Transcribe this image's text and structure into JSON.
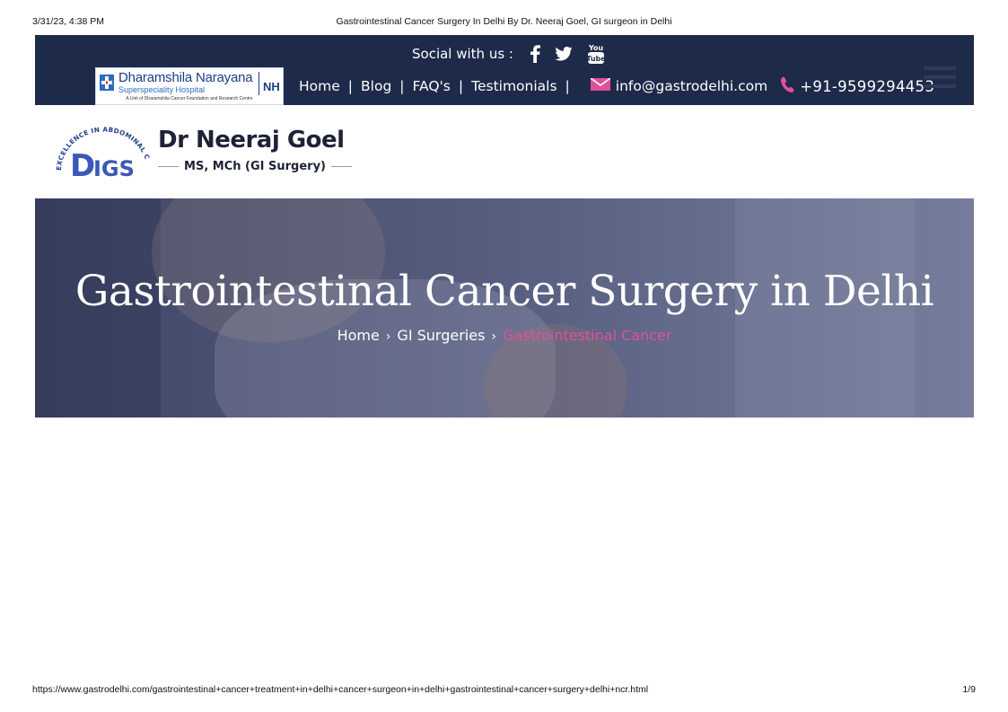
{
  "print_header": {
    "datetime": "3/31/23, 4:38 PM",
    "title": "Gastrointestinal Cancer Surgery In Delhi By Dr. Neeraj Goel, GI surgeon in Delhi"
  },
  "topbar": {
    "background": "#1e2a4a",
    "social_label": "Social with us :",
    "social_icons": [
      "facebook-icon",
      "twitter-icon",
      "youtube-icon"
    ],
    "youtube_text": "You Tube",
    "hospital": {
      "name": "Dharamshila Narayana",
      "subtitle": "Superspeciality Hospital",
      "unit_line": "A Unit of Dharamshila Cancer Foundation and Research Centre",
      "badge": "NH"
    },
    "nav": {
      "items": [
        "Home",
        "Blog",
        "FAQ's",
        "Testimonials"
      ],
      "separator": "|",
      "email": "info@gastrodelhi.com",
      "phone": "+91-9599294453"
    },
    "menu_icon": "hamburger-icon"
  },
  "brand": {
    "ring_text": "EXCELLENCE IN ABDOMINAL CARE",
    "logo_text": "DIGS",
    "doctor_name": "Dr Neeraj Goel",
    "qualifications": "MS, MCh (GI Surgery)"
  },
  "hero": {
    "title": "Gastrointestinal Cancer Surgery in Delhi",
    "breadcrumbs": [
      "Home",
      "GI Surgeries",
      "Gastrointestinal Cancer"
    ],
    "breadcrumb_separator": "›",
    "active_color": "#e0509a"
  },
  "print_footer": {
    "url": "https://www.gastrodelhi.com/gastrointestinal+cancer+treatment+in+delhi+cancer+surgeon+in+delhi+gastrointestinal+cancer+surgery+delhi+ncr.html",
    "page": "1/9"
  }
}
